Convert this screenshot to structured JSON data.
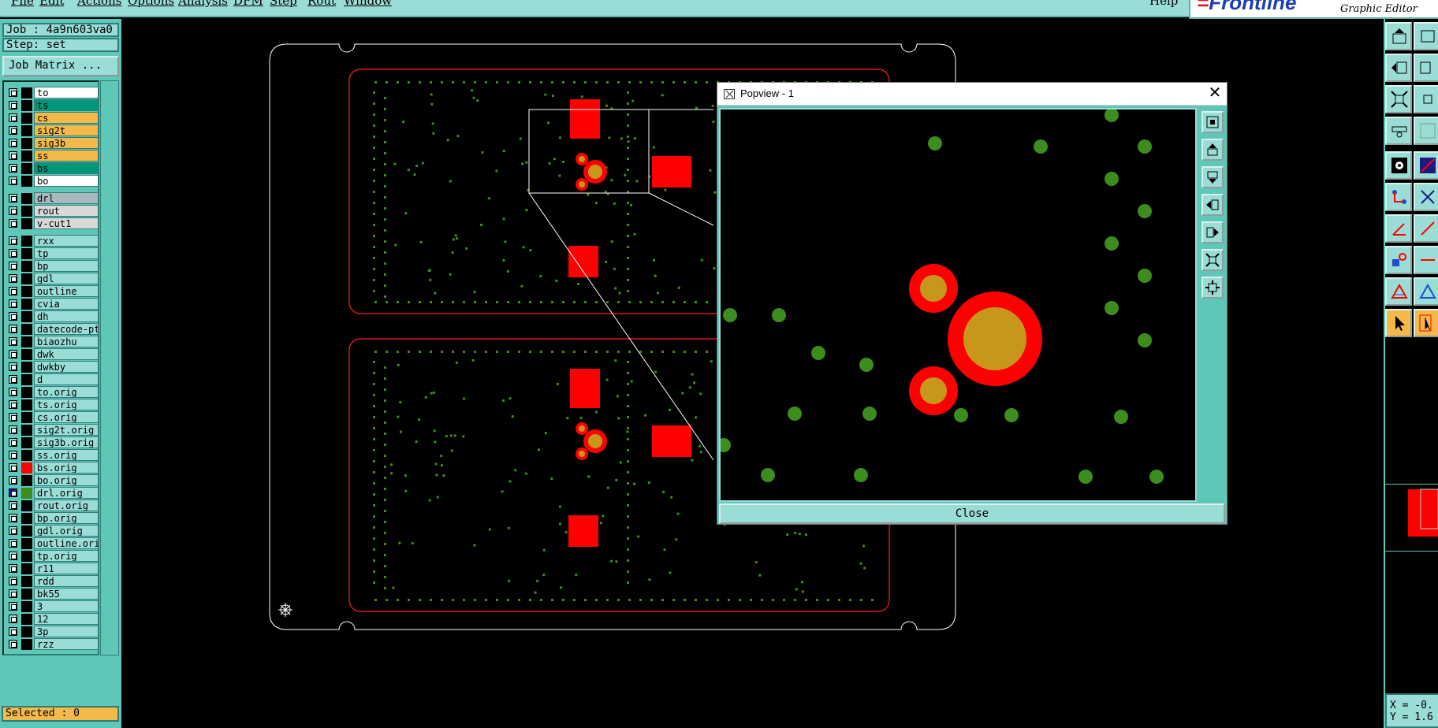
{
  "menu": {
    "items": [
      "File",
      "Edit",
      "Actions",
      "Options",
      "Analysis",
      "DFM",
      "Step",
      "Rout",
      "Window"
    ],
    "help": "Help"
  },
  "brand": {
    "logo": "Frontline",
    "subtitle": "Graphic Editor"
  },
  "job": {
    "label": "Job : 4a9n603va0",
    "step": "Step: set",
    "matrix_button": "Job Matrix ..."
  },
  "layers": [
    {
      "name": "to",
      "color": "#ffffff",
      "swatch": "#000000",
      "on": false
    },
    {
      "name": "ts",
      "color": "#00967a",
      "swatch": "#000000",
      "on": false
    },
    {
      "name": "cs",
      "color": "#f5b94a",
      "swatch": "#000000",
      "on": false
    },
    {
      "name": "sig2t",
      "color": "#f5b94a",
      "swatch": "#000000",
      "on": false
    },
    {
      "name": "sig3b",
      "color": "#f5b94a",
      "swatch": "#000000",
      "on": false
    },
    {
      "name": "ss",
      "color": "#f5b94a",
      "swatch": "#000000",
      "on": false
    },
    {
      "name": "bs",
      "color": "#00967a",
      "swatch": "#000000",
      "on": false
    },
    {
      "name": "bo",
      "color": "#ffffff",
      "swatch": "#000000",
      "on": false
    },
    {
      "name": "drl",
      "color": "#a9b9bd",
      "swatch": "#000000",
      "on": false
    },
    {
      "name": "rout",
      "color": "#d9d9d9",
      "swatch": "#000000",
      "on": false
    },
    {
      "name": "v-cut1",
      "color": "#d9d9d9",
      "swatch": "#000000",
      "on": false
    },
    {
      "name": "rxx",
      "color": "#9adcd6",
      "swatch": "#000000",
      "on": false
    },
    {
      "name": "tp",
      "color": "#9adcd6",
      "swatch": "#000000",
      "on": false
    },
    {
      "name": "bp",
      "color": "#9adcd6",
      "swatch": "#000000",
      "on": false
    },
    {
      "name": "gdl",
      "color": "#9adcd6",
      "swatch": "#000000",
      "on": false
    },
    {
      "name": "outline",
      "color": "#9adcd6",
      "swatch": "#000000",
      "on": false
    },
    {
      "name": "cvia",
      "color": "#9adcd6",
      "swatch": "#000000",
      "on": false
    },
    {
      "name": "dh",
      "color": "#9adcd6",
      "swatch": "#000000",
      "on": false
    },
    {
      "name": "datecode-pte",
      "color": "#9adcd6",
      "swatch": "#000000",
      "on": false
    },
    {
      "name": "biaozhu",
      "color": "#9adcd6",
      "swatch": "#000000",
      "on": false
    },
    {
      "name": "dwk",
      "color": "#9adcd6",
      "swatch": "#000000",
      "on": false
    },
    {
      "name": "dwkby",
      "color": "#9adcd6",
      "swatch": "#000000",
      "on": false
    },
    {
      "name": "d",
      "color": "#9adcd6",
      "swatch": "#000000",
      "on": false
    },
    {
      "name": "to.orig",
      "color": "#9adcd6",
      "swatch": "#000000",
      "on": false
    },
    {
      "name": "ts.orig",
      "color": "#9adcd6",
      "swatch": "#000000",
      "on": false
    },
    {
      "name": "cs.orig",
      "color": "#9adcd6",
      "swatch": "#000000",
      "on": false
    },
    {
      "name": "sig2t.orig",
      "color": "#9adcd6",
      "swatch": "#000000",
      "on": false
    },
    {
      "name": "sig3b.orig",
      "color": "#9adcd6",
      "swatch": "#000000",
      "on": false
    },
    {
      "name": "ss.orig",
      "color": "#9adcd6",
      "swatch": "#000000",
      "on": false
    },
    {
      "name": "bs.orig",
      "color": "#9adcd6",
      "swatch": "#ff0000",
      "on": false
    },
    {
      "name": "bo.orig",
      "color": "#9adcd6",
      "swatch": "#000000",
      "on": false
    },
    {
      "name": "drl.orig",
      "color": "#9adcd6",
      "swatch": "#3c8c1e",
      "on": true
    },
    {
      "name": "rout.orig",
      "color": "#9adcd6",
      "swatch": "#000000",
      "on": false
    },
    {
      "name": "bp.orig",
      "color": "#9adcd6",
      "swatch": "#000000",
      "on": false
    },
    {
      "name": "gdl.orig",
      "color": "#9adcd6",
      "swatch": "#000000",
      "on": false
    },
    {
      "name": "outline.orig",
      "color": "#9adcd6",
      "swatch": "#000000",
      "on": false
    },
    {
      "name": "tp.orig",
      "color": "#9adcd6",
      "swatch": "#000000",
      "on": false
    },
    {
      "name": "r11",
      "color": "#9adcd6",
      "swatch": "#000000",
      "on": false
    },
    {
      "name": "rdd",
      "color": "#9adcd6",
      "swatch": "#000000",
      "on": false
    },
    {
      "name": "bk55",
      "color": "#9adcd6",
      "swatch": "#000000",
      "on": false
    },
    {
      "name": "3",
      "color": "#9adcd6",
      "swatch": "#000000",
      "on": false
    },
    {
      "name": "12",
      "color": "#9adcd6",
      "swatch": "#000000",
      "on": false
    },
    {
      "name": "3p",
      "color": "#9adcd6",
      "swatch": "#000000",
      "on": false
    },
    {
      "name": "rzz",
      "color": "#9adcd6",
      "swatch": "#000000",
      "on": false
    }
  ],
  "status": {
    "selected": "Selected : 0"
  },
  "popview": {
    "title": "Popview - 1",
    "close_x": "✕",
    "close_button": "Close"
  },
  "coords": {
    "x": "X = -0.",
    "y": "Y = 1.6"
  },
  "colors": {
    "pad": "#ff0000",
    "drill": "#3c8c1e",
    "annular": "#c8961a",
    "panel_frame": "#ffffff",
    "board_outline": "#ff2020",
    "ui_teal": "#5fc7b8",
    "ui_light": "#9adcd6",
    "highlight": "#f5b94a"
  }
}
